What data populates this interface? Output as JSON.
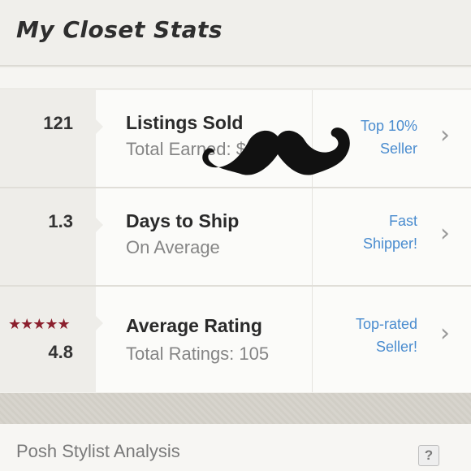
{
  "header": {
    "title": "My Closet Stats"
  },
  "stats": [
    {
      "value": "121",
      "label": "Listings Sold",
      "sub": "Total Earned: $",
      "badge_line1": "Top 10%",
      "badge_line2": "Seller"
    },
    {
      "value": "1.3",
      "label": "Days to Ship",
      "sub": "On Average",
      "badge_line1": "Fast",
      "badge_line2": "Shipper!"
    },
    {
      "value": "4.8",
      "stars": "★★★★★",
      "label": "Average Rating",
      "sub": "Total Ratings: 105",
      "badge_line1": "Top-rated",
      "badge_line2": "Seller!"
    }
  ],
  "footer": {
    "title": "Posh Stylist Analysis",
    "help_icon": "?"
  },
  "colors": {
    "accent": "#4a8ccf",
    "star": "#8b1f2d"
  }
}
